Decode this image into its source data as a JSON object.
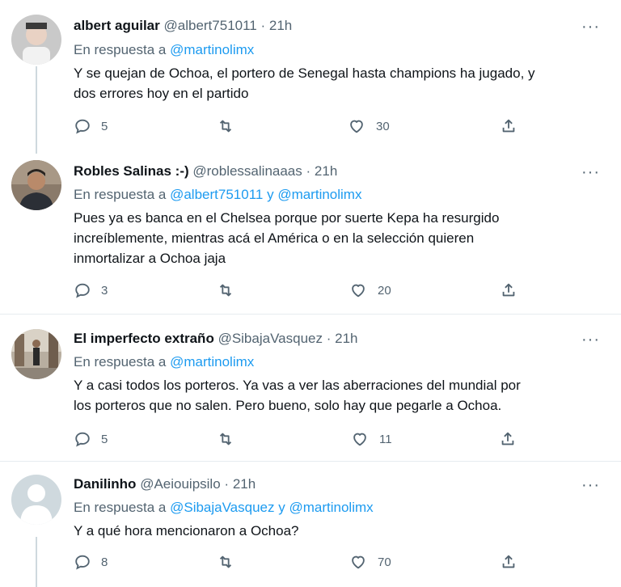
{
  "more_glyph": "···",
  "tweets": [
    {
      "name": "albert aguilar",
      "handle": "@albert751011",
      "dot": "·",
      "time": "21h",
      "reply_prefix": "En respuesta a",
      "mentions": [
        "@martinolimx"
      ],
      "mention_joiner": "",
      "text_lines": [
        "Y se quejan de Ochoa, el portero de Senegal hasta champions ha jugado, y",
        "dos errores hoy en el partido"
      ],
      "replies": "5",
      "retweets": "",
      "likes": "30"
    },
    {
      "name": "Robles Salinas :-)",
      "handle": "@roblessalinaaas",
      "dot": "·",
      "time": "21h",
      "reply_prefix": "En respuesta a",
      "mentions": [
        "@albert751011",
        "@martinolimx"
      ],
      "mention_joiner": "y",
      "text_lines": [
        "Pues ya es banca en el Chelsea porque por suerte Kepa ha resurgido",
        "increíblemente, mientras acá el América o en la selección quieren",
        "inmortalizar a Ochoa jaja"
      ],
      "replies": "3",
      "retweets": "",
      "likes": "20"
    },
    {
      "name": "El imperfecto extraño",
      "handle": "@SibajaVasquez",
      "dot": "·",
      "time": "21h",
      "reply_prefix": "En respuesta a",
      "mentions": [
        "@martinolimx"
      ],
      "mention_joiner": "",
      "text_lines": [
        "Y a casi todos los porteros. Ya vas a ver las aberraciones del mundial por",
        "los porteros que no salen. Pero bueno, solo hay que pegarle a Ochoa."
      ],
      "replies": "5",
      "retweets": "",
      "likes": "11"
    },
    {
      "name": "Danilinho",
      "handle": "@Aeiouipsilo",
      "dot": "·",
      "time": "21h",
      "reply_prefix": "En respuesta a",
      "mentions": [
        "@SibajaVasquez",
        "@martinolimx"
      ],
      "mention_joiner": "y",
      "text_lines": [
        "Y a qué hora mencionaron a Ochoa?"
      ],
      "replies": "8",
      "retweets": "",
      "likes": "70"
    }
  ],
  "icons": {
    "reply": "reply-icon",
    "retweet": "retweet-icon",
    "like": "like-icon",
    "share": "share-icon",
    "more": "more-icon"
  },
  "colors": {
    "text": "#0f1419",
    "secondary": "#536471",
    "mention": "#1d9bf0",
    "thread_line": "#cfd9de",
    "divider": "#e6ecf0"
  }
}
